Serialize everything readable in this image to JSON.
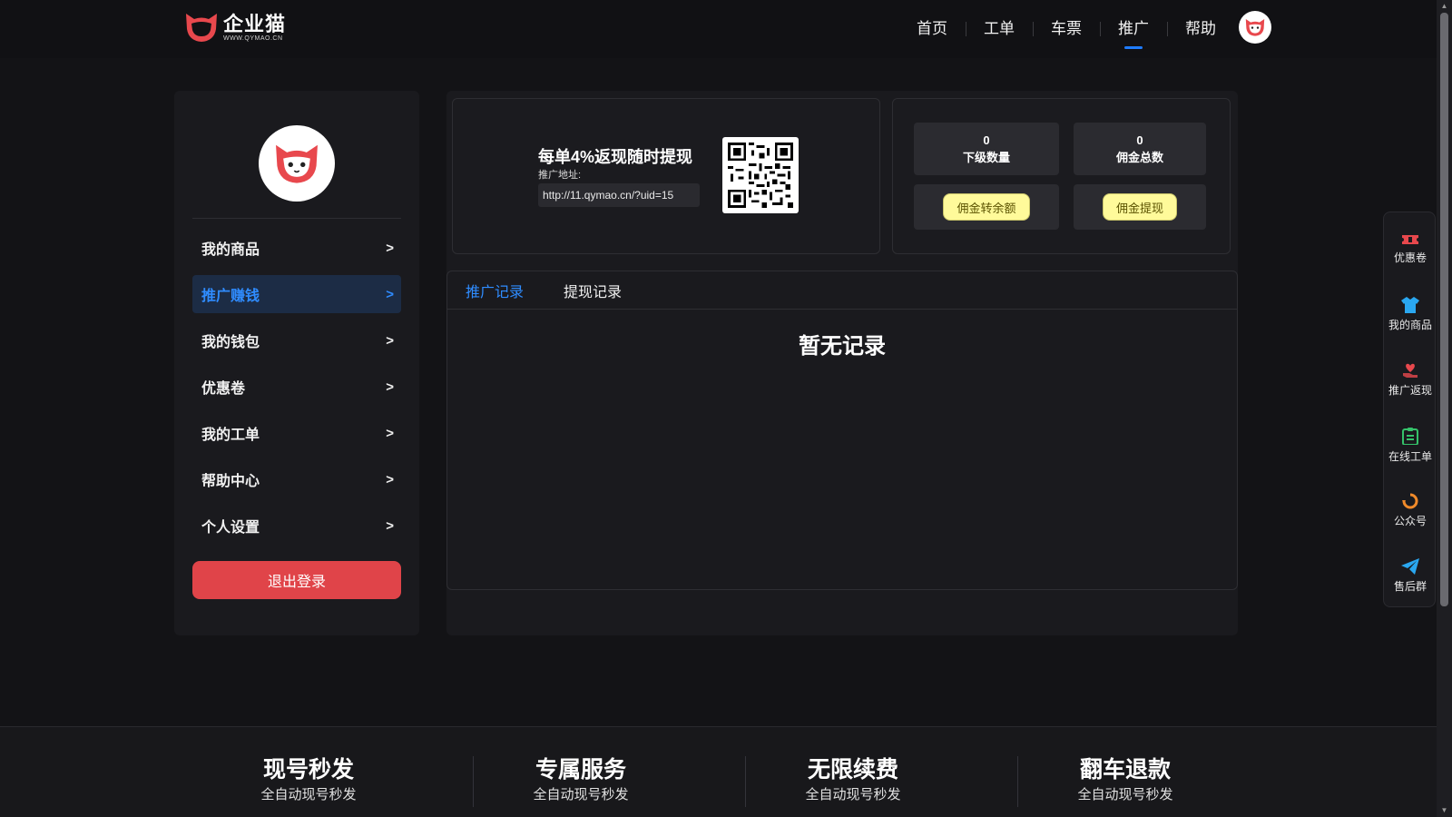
{
  "header": {
    "logo_name": "企业猫",
    "logo_url": "WWW.QYMAO.CN",
    "nav": [
      {
        "label": "首页",
        "active": false
      },
      {
        "label": "工单",
        "active": false
      },
      {
        "label": "车票",
        "active": false
      },
      {
        "label": "推广",
        "active": true
      },
      {
        "label": "帮助",
        "active": false
      }
    ],
    "avatar_icon": "cat-avatar-icon"
  },
  "sidebar": {
    "avatar_icon": "cat-avatar-icon",
    "items": [
      {
        "label": "我的商品",
        "arrow": ">",
        "active": false
      },
      {
        "label": "推广赚钱",
        "arrow": ">",
        "active": true
      },
      {
        "label": "我的钱包",
        "arrow": ">",
        "active": false
      },
      {
        "label": "优惠卷",
        "arrow": ">",
        "active": false
      },
      {
        "label": "我的工单",
        "arrow": ">",
        "active": false
      },
      {
        "label": "帮助中心",
        "arrow": ">",
        "active": false
      },
      {
        "label": "个人设置",
        "arrow": ">",
        "active": false
      }
    ],
    "logout_label": "退出登录"
  },
  "promo": {
    "title": "每单4%返现随时提现",
    "address_label": "推广地址:",
    "link": "http://11.qymao.cn/?uid=15",
    "qr_icon": "qr-code-icon"
  },
  "stats": {
    "sub_count_value": "0",
    "sub_count_label": "下级数量",
    "commission_total_value": "0",
    "commission_total_label": "佣金总数",
    "to_balance_label": "佣金转余额",
    "withdraw_label": "佣金提现"
  },
  "records": {
    "tabs": [
      {
        "label": "推广记录",
        "active": true
      },
      {
        "label": "提现记录",
        "active": false
      }
    ],
    "empty_text": "暂无记录"
  },
  "float_bar": [
    {
      "label": "优惠卷",
      "icon": "coupon-icon",
      "color": "#e8484d"
    },
    {
      "label": "我的商品",
      "icon": "shirt-icon",
      "color": "#2aa7f0"
    },
    {
      "label": "推广返现",
      "icon": "heart-hand-icon",
      "color": "#e8484d"
    },
    {
      "label": "在线工单",
      "icon": "clipboard-icon",
      "color": "#35c26a"
    },
    {
      "label": "公众号",
      "icon": "refresh-icon",
      "color": "#f08a2a"
    },
    {
      "label": "售后群",
      "icon": "send-icon",
      "color": "#2aa7f0"
    }
  ],
  "footer": {
    "features": [
      {
        "title": "现号秒发",
        "subtitle": "全自动现号秒发"
      },
      {
        "title": "专属服务",
        "subtitle": "全自动现号秒发"
      },
      {
        "title": "无限续费",
        "subtitle": "全自动现号秒发"
      },
      {
        "title": "翻车退款",
        "subtitle": "全自动现号秒发"
      }
    ]
  },
  "colors": {
    "accent": "#2f8cff",
    "logout": "#e04449",
    "brand_red": "#e8484d",
    "button_yellow": "#fffa9a"
  }
}
